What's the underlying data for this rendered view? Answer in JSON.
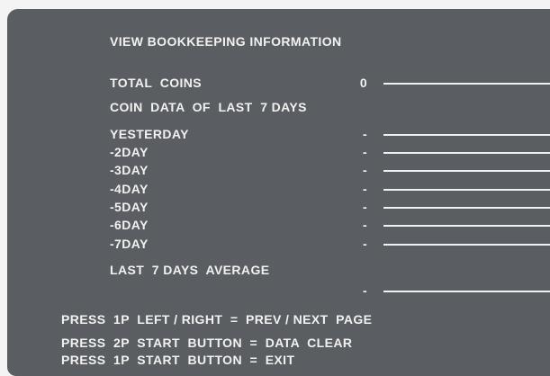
{
  "screen": {
    "title": "VIEW BOOKKEEPING INFORMATION",
    "total_coins": {
      "label": "TOTAL  COINS",
      "value": "0"
    },
    "coin_data_heading": "COIN  DATA  OF  LAST  7 DAYS",
    "days": [
      {
        "label": "YESTERDAY",
        "value": "-"
      },
      {
        "label": "-2DAY",
        "value": "-"
      },
      {
        "label": "-3DAY",
        "value": "-"
      },
      {
        "label": "-4DAY",
        "value": "-"
      },
      {
        "label": "-5DAY",
        "value": "-"
      },
      {
        "label": "-6DAY",
        "value": "-"
      },
      {
        "label": "-7DAY",
        "value": "-"
      }
    ],
    "average": {
      "label": "LAST  7 DAYS  AVERAGE",
      "value": "-"
    },
    "instructions": [
      "PRESS  1P  LEFT / RIGHT  =  PREV / NEXT  PAGE",
      "PRESS  2P  START  BUTTON  =  DATA  CLEAR",
      "PRESS  1P  START  BUTTON  =  EXIT"
    ]
  }
}
